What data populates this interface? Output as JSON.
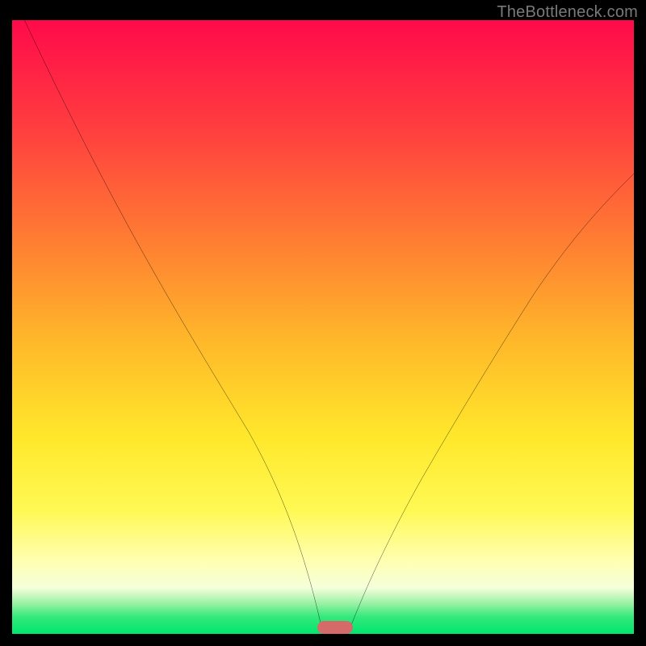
{
  "watermark": "TheBottleneck.com",
  "chart_data": {
    "type": "line",
    "title": "",
    "xlabel": "",
    "ylabel": "",
    "xlim": [
      0,
      100
    ],
    "ylim": [
      0,
      100
    ],
    "series": [
      {
        "name": "left-curve",
        "x": [
          2,
          6,
          12,
          18,
          24,
          30,
          36,
          42,
          47,
          50
        ],
        "y": [
          100,
          90,
          78,
          67,
          56.5,
          46,
          35,
          22.5,
          9,
          0
        ]
      },
      {
        "name": "right-curve",
        "x": [
          54,
          58,
          63,
          69,
          75,
          81,
          87,
          93,
          100
        ],
        "y": [
          0,
          6.5,
          14,
          24,
          34,
          44.5,
          55,
          64.5,
          75
        ]
      }
    ],
    "marker": {
      "x": 52,
      "y": 0,
      "color": "#d56a6a"
    },
    "background_gradient": {
      "top": "#ff0a4a",
      "bottom": "#00e56f"
    }
  }
}
